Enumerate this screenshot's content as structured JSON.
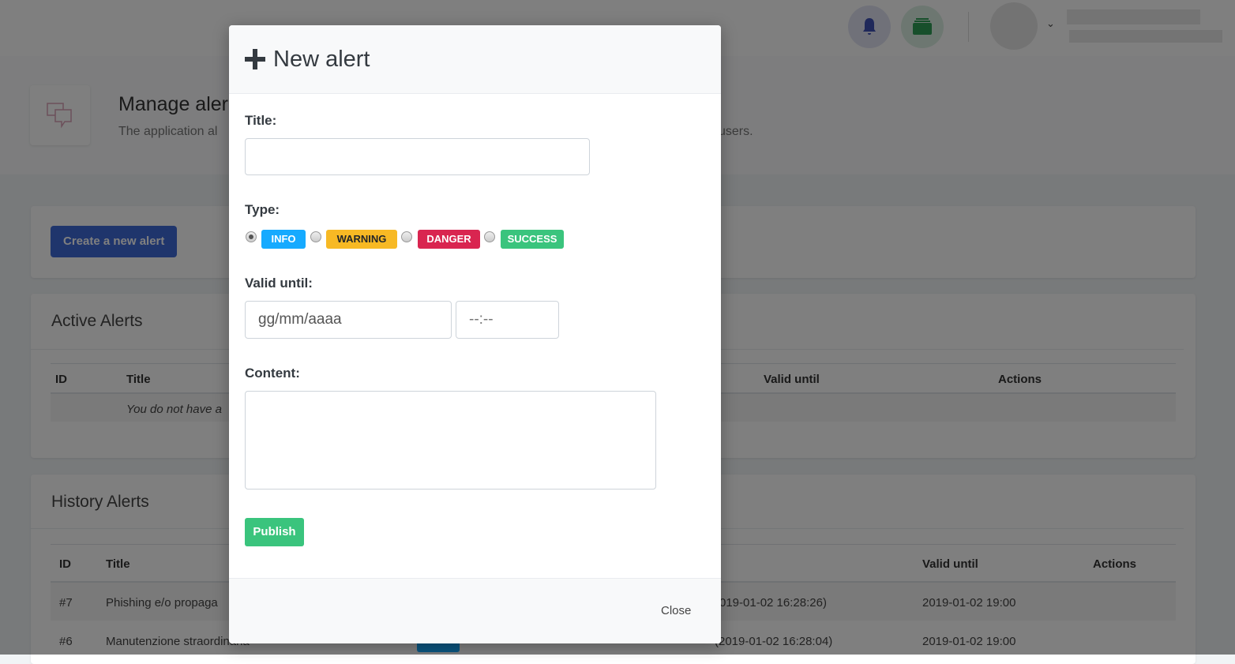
{
  "header": {
    "notification_icon": "bell-icon",
    "apps_icon": "layers-icon",
    "user_menu_icon": "chevron-down-icon"
  },
  "page": {
    "title": "Manage aler",
    "subtitle_left": "The application al",
    "subtitle_right": "users.",
    "icon": "chat-bubbles-icon"
  },
  "create_button": "Create a new alert",
  "active": {
    "title": "Active Alerts",
    "columns": [
      "ID",
      "Title",
      "Valid until",
      "Actions"
    ],
    "empty": "You do not have a"
  },
  "history": {
    "title": "History Alerts",
    "columns": [
      "ID",
      "Title",
      "Valid until",
      "Actions"
    ],
    "rows": [
      {
        "id": "#7",
        "title": "Phishing e/o propaga",
        "created": "019-01-02 16:28:26)",
        "valid": "2019-01-02 19:00"
      },
      {
        "id": "#6",
        "title": "Manutenzione straordinaria",
        "created": "(2019-01-02 16:28:04)",
        "valid": "2019-01-02 19:00"
      }
    ]
  },
  "modal": {
    "title": "New alert",
    "title_icon": "plus-icon",
    "title_label": "Title:",
    "title_value": "",
    "type_label": "Type:",
    "types": [
      {
        "label": "INFO",
        "color": "#16aaff",
        "selected": true
      },
      {
        "label": "WARNING",
        "color": "#f7b924"
      },
      {
        "label": "DANGER",
        "color": "#d92550"
      },
      {
        "label": "SUCCESS",
        "color": "#3ac47d"
      }
    ],
    "valid_label": "Valid until:",
    "date_placeholder": "gg/mm/aaaa",
    "time_placeholder": "--:--",
    "content_label": "Content:",
    "content_value": "",
    "publish": "Publish",
    "close": "Close"
  }
}
